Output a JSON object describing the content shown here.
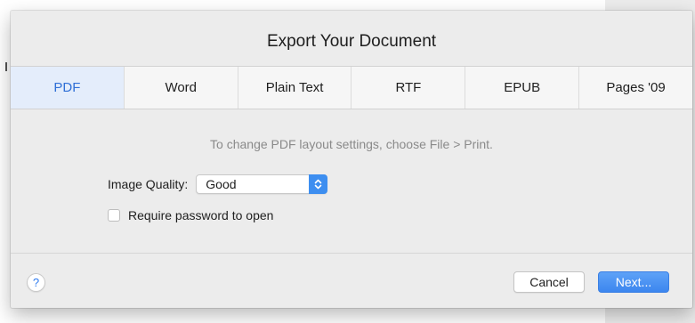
{
  "dialog": {
    "title": "Export Your Document",
    "tabs": [
      {
        "label": "PDF",
        "active": true
      },
      {
        "label": "Word",
        "active": false
      },
      {
        "label": "Plain Text",
        "active": false
      },
      {
        "label": "RTF",
        "active": false
      },
      {
        "label": "EPUB",
        "active": false
      },
      {
        "label": "Pages '09",
        "active": false
      }
    ],
    "hint": "To change PDF layout settings, choose File > Print.",
    "image_quality": {
      "label": "Image Quality:",
      "value": "Good"
    },
    "password": {
      "label": "Require password to open",
      "checked": false
    },
    "help_label": "?",
    "buttons": {
      "cancel": "Cancel",
      "next": "Next..."
    }
  },
  "colors": {
    "accent": "#3d8ef0",
    "active_tab_bg": "#e4edfb",
    "active_tab_text": "#2f6fd6",
    "hint_text": "#8a8a8a"
  },
  "icons": {
    "help": "question-mark-icon",
    "select_arrows": "up-down-chevrons-icon"
  }
}
